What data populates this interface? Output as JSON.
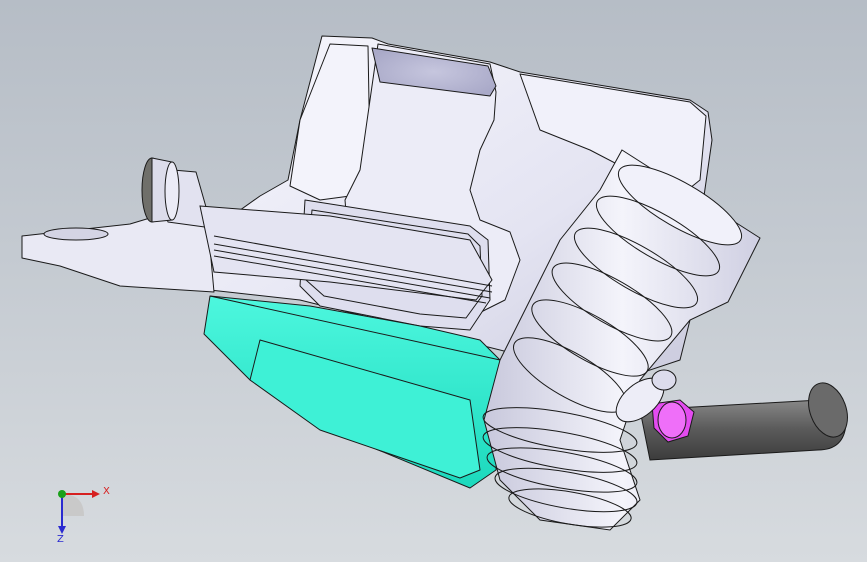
{
  "viewport": {
    "background_top": "#b6bdc6",
    "background_bottom": "#d7dbdf"
  },
  "model": {
    "parts": [
      {
        "name": "tank-body",
        "color": "#e6e6f3"
      },
      {
        "name": "lower-tray",
        "color": "#28f2d5"
      },
      {
        "name": "intake-bellows",
        "color": "#e8e8f4"
      },
      {
        "name": "outlet-hose",
        "color": "#5e5e5e"
      },
      {
        "name": "hose-clamp",
        "color": "#e34bf0"
      },
      {
        "name": "filler-cap",
        "color": "#6f6f6a"
      }
    ],
    "edge_color": "#1a1a1a"
  },
  "triad": {
    "x_label": "X",
    "y_label": "",
    "z_label": "Z",
    "x_color": "#d62020",
    "y_color": "#1aa01a",
    "z_color": "#2a2ad0"
  }
}
